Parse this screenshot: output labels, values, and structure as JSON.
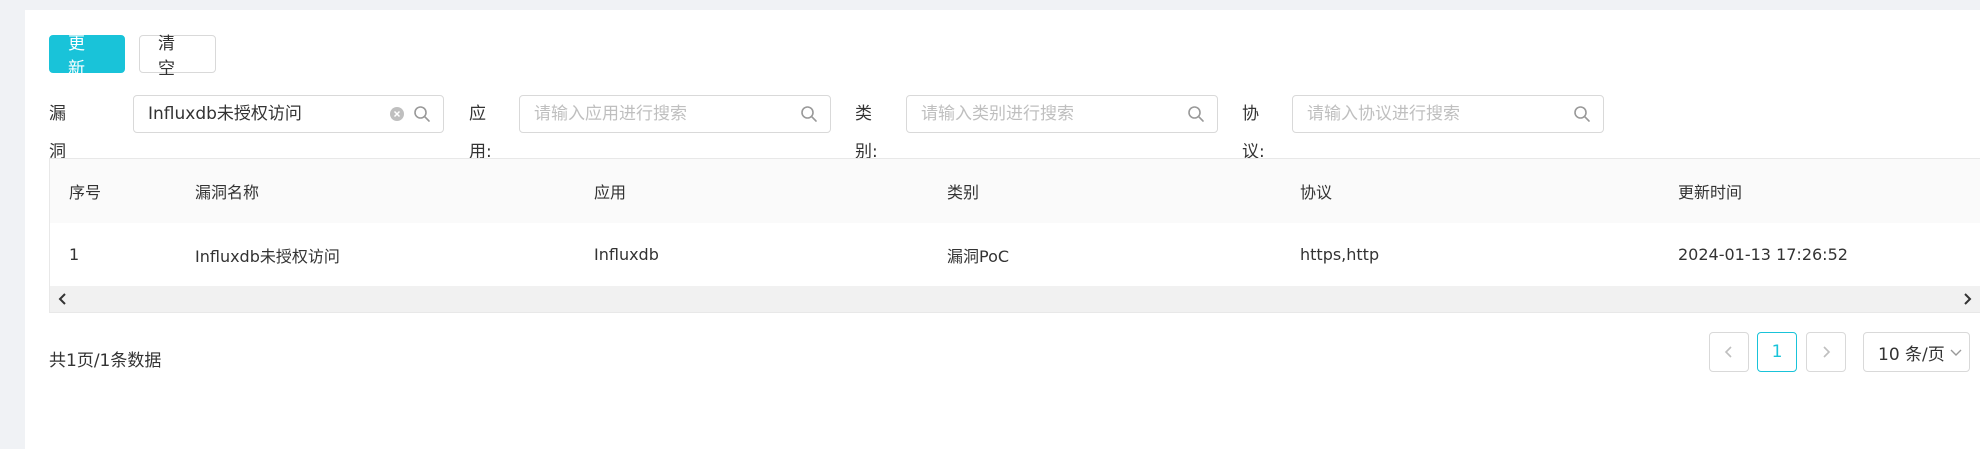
{
  "toolbar": {
    "update_label": "更新",
    "clear_label": "清空"
  },
  "filters": {
    "vuln_name": {
      "label": "漏洞名称:",
      "value": "Influxdb未授权访问"
    },
    "app": {
      "label": "应用:",
      "placeholder": "请输入应用进行搜索"
    },
    "category": {
      "label": "类别:",
      "placeholder": "请输入类别进行搜索"
    },
    "protocol": {
      "label": "协议:",
      "placeholder": "请输入协议进行搜索"
    }
  },
  "table": {
    "columns": [
      "序号",
      "漏洞名称",
      "应用",
      "类别",
      "协议",
      "更新时间"
    ],
    "rows": [
      [
        "1",
        "Influxdb未授权访问",
        "Influxdb",
        "漏洞PoC",
        "https,http",
        "2024-01-13 17:26:52"
      ]
    ]
  },
  "pagination": {
    "summary": "共1页/1条数据",
    "current_page": "1",
    "page_size": "10 条/页"
  },
  "colors": {
    "accent": "#19c3d9",
    "border": "#d9d9d9"
  }
}
